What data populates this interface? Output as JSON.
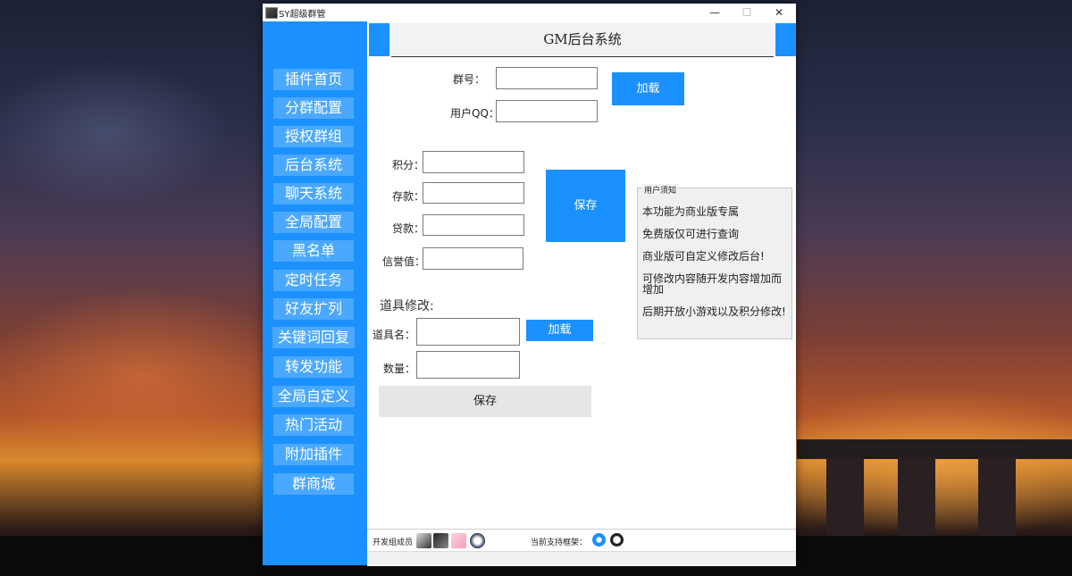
{
  "window": {
    "title": "SY超级群管",
    "minimize_icon": "minimize-icon",
    "maximize_icon": "maximize-icon",
    "close_icon": "close-icon",
    "minimize_glyph": "—",
    "maximize_glyph": "☐",
    "close_glyph": "✕"
  },
  "sidebar": {
    "items": [
      {
        "label": "插件首页"
      },
      {
        "label": "分群配置"
      },
      {
        "label": "授权群组"
      },
      {
        "label": "后台系统"
      },
      {
        "label": "聊天系统"
      },
      {
        "label": "全局配置"
      },
      {
        "label": "黑名单"
      },
      {
        "label": "定时任务"
      },
      {
        "label": "好友扩列"
      },
      {
        "label": "关键词回复"
      },
      {
        "label": "转发功能"
      },
      {
        "label": "全局自定义"
      },
      {
        "label": "热门活动"
      },
      {
        "label": "附加插件"
      },
      {
        "label": "群商城"
      }
    ]
  },
  "header": {
    "title": "GM后台系统"
  },
  "lookup": {
    "group_label": "群号：",
    "group_value": "",
    "qq_label": "用户QQ：",
    "qq_value": "",
    "load_button": "加载"
  },
  "stats": {
    "points_label": "积分：",
    "points_value": "",
    "deposit_label": "存款：",
    "deposit_value": "",
    "loan_label": "贷款：",
    "loan_value": "",
    "credit_label": "信誉值：",
    "credit_value": "",
    "save_button": "保存"
  },
  "notice": {
    "title": "用户须知",
    "lines": [
      "本功能为商业版专属",
      "免费版仅可进行查询",
      "商业版可自定义修改后台!",
      "可修改内容随开发内容增加而增加",
      "后期开放小游戏以及积分修改!"
    ]
  },
  "items": {
    "section_title": "道具修改:",
    "name_label": "道具名：",
    "name_value": "",
    "load_button": "加载",
    "qty_label": "数量：",
    "qty_value": "",
    "save_button": "保存"
  },
  "footer": {
    "dev_label": "开发组成员",
    "framework_label": "当前支持框架：",
    "colors": {
      "accent": "#1b90ff",
      "sidebar_item": "#4aa8ff"
    }
  }
}
